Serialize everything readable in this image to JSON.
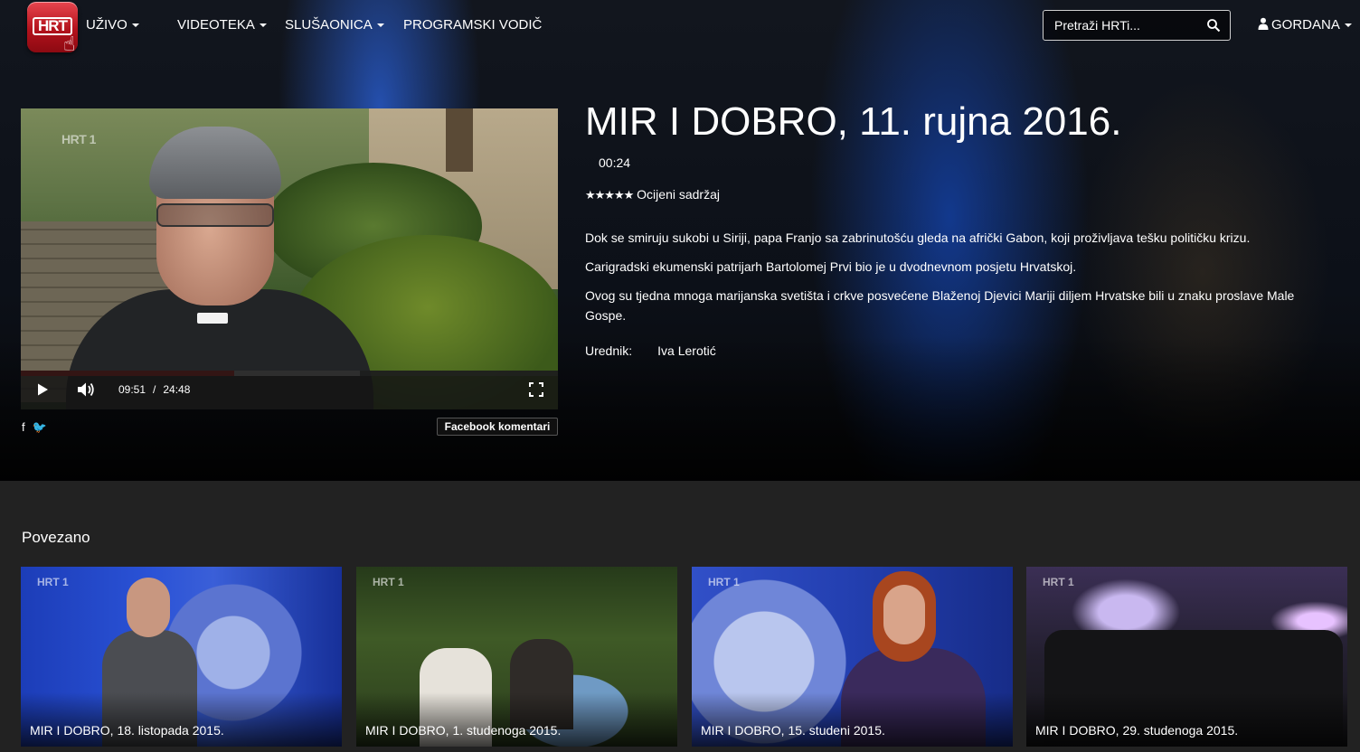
{
  "nav": {
    "logo_text": "HRT",
    "items": [
      {
        "label": "UŽIVO",
        "dropdown": true
      },
      {
        "label": "VIDEOTEKA",
        "dropdown": true
      },
      {
        "label": "SLUŠAONICA",
        "dropdown": true
      },
      {
        "label": "PROGRAMSKI VODIČ",
        "dropdown": false
      }
    ],
    "search_placeholder": "Pretraži HRTi...",
    "user": "GORDANA"
  },
  "player": {
    "watermark": "HRT 1",
    "current_time": "09:51",
    "separator": "/",
    "total_time": "24:48",
    "played_fraction": 0.398,
    "buffered_fraction": 0.631
  },
  "share": {
    "facebook_comments": "Facebook komentari"
  },
  "info": {
    "title": "MIR I DOBRO, 11. rujna 2016.",
    "duration": "00:24",
    "stars": "★★★★★",
    "rate_label": "Ocijeni sadržaj",
    "paragraphs": [
      "Dok se smiruju sukobi u Siriji, papa Franjo sa zabrinutošću gleda na afrički Gabon, koji proživljava tešku političku krizu.",
      "Carigradski ekumenski patrijarh Bartolomej Prvi bio je u dvodnevnom posjetu Hrvatskoj.",
      "Ovog su tjedna mnoga marijanska svetišta i crkve posvećene Blaženoj Djevici Mariji diljem Hrvatske bili u znaku proslave Male Gospe."
    ],
    "editor_label": "Urednik:",
    "editor_name": "Iva Lerotić"
  },
  "related": {
    "title": "Povezano",
    "items": [
      {
        "label": "MIR I DOBRO, 18. listopada 2015.",
        "watermark": "HRT 1"
      },
      {
        "label": "MIR I DOBRO, 1. studenoga 2015.",
        "watermark": "HRT 1"
      },
      {
        "label": "MIR I DOBRO, 15. studeni 2015.",
        "watermark": "HRT 1"
      },
      {
        "label": "MIR I DOBRO, 29. studenoga 2015.",
        "watermark": "HRT 1"
      }
    ]
  },
  "colors": {
    "accent": "#e41b17",
    "logo": "#b3121c"
  }
}
